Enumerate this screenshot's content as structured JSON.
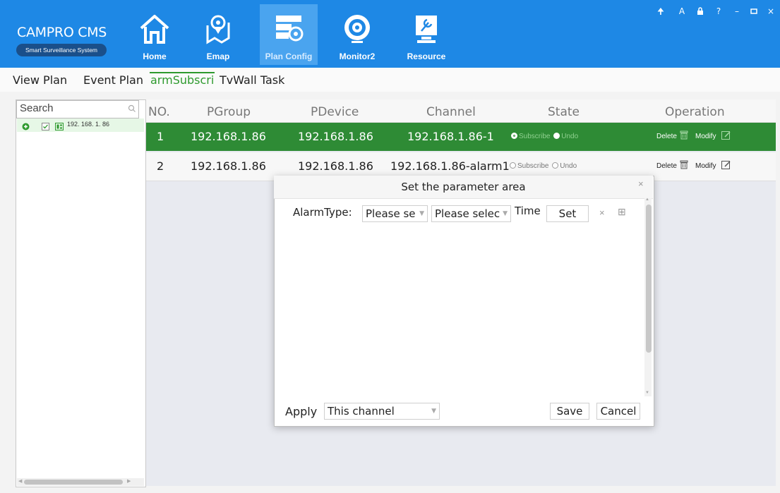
{
  "app": {
    "title": "CAMPRO CMS",
    "subtitle": "Smart Surveillance System"
  },
  "nav": [
    {
      "label": "Home",
      "icon": "home-icon"
    },
    {
      "label": "Emap",
      "icon": "map-pin-icon"
    },
    {
      "label": "Plan Config",
      "icon": "plan-config-icon",
      "active": true
    },
    {
      "label": "Monitor2",
      "icon": "monitor-icon"
    },
    {
      "label": "Resource",
      "icon": "resource-wrench-icon"
    }
  ],
  "window_controls": {
    "pin": "🠉",
    "user": "A",
    "lock": "🔒",
    "help": "?",
    "minimize": "–",
    "maximize": "▫",
    "close": "×"
  },
  "tabs": [
    {
      "label": "View Plan"
    },
    {
      "label": "Event Plan"
    },
    {
      "label": "armSubscril",
      "active": true
    },
    {
      "label": "TvWall Task"
    }
  ],
  "left": {
    "search_placeholder": "Search",
    "tree_item": "192. 168. 1. 86"
  },
  "grid": {
    "headers": [
      "NO.",
      "PGroup",
      "PDevice",
      "Channel",
      "State",
      "Operation"
    ],
    "rows": [
      {
        "no": "1",
        "pgroup": "192.168.1.86",
        "pdevice": "192.168.1.86",
        "channel": "192.168.1.86-1",
        "subscribe": "Subscribe",
        "undo": "Undo",
        "delete": "Delete",
        "modify": "Modify",
        "selected": true
      },
      {
        "no": "2",
        "pgroup": "192.168.1.86",
        "pdevice": "192.168.1.86",
        "channel": "192.168.1.86-alarm1",
        "subscribe": "Subscribe",
        "undo": "Undo",
        "delete": "Delete",
        "modify": "Modify",
        "selected": false
      }
    ]
  },
  "dialog": {
    "title": "Set the parameter area",
    "alarm_type_label": "AlarmType:",
    "select1": "Please se",
    "select2": "Please selec",
    "time_label": "Time",
    "set_button": "Set",
    "remove": "×",
    "add": "⊞",
    "apply_label": "Apply",
    "apply_value": "This channel",
    "save": "Save",
    "cancel": "Cancel",
    "close": "×"
  },
  "colors": {
    "header": "#1e88e5",
    "selected_row": "#2e8b35",
    "active_tab": "#2e9a2e"
  }
}
